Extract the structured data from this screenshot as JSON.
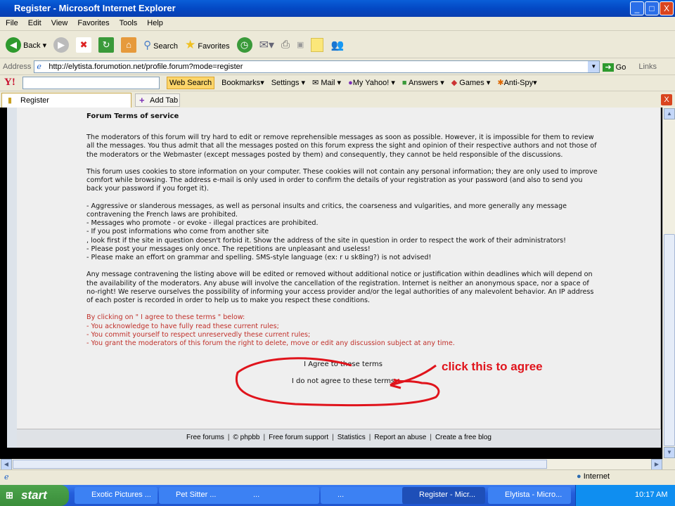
{
  "window": {
    "title": "Register - Microsoft Internet Explorer",
    "minimize": "_",
    "maximize": "□",
    "close": "X"
  },
  "menu": [
    "File",
    "Edit",
    "View",
    "Favorites",
    "Tools",
    "Help"
  ],
  "toolbar": {
    "back": "Back",
    "search": "Search",
    "favorites": "Favorites"
  },
  "address": {
    "label": "Address",
    "url": "http://elytista.forumotion.net/profile.forum?mode=register",
    "go": "Go",
    "links": "Links"
  },
  "yahoo": {
    "logo": "Y!",
    "search_value": "",
    "web_search": "Web Search",
    "bookmarks": "Bookmarks",
    "settings": "Settings",
    "mail": "Mail",
    "my_yahoo": "My Yahoo!",
    "answers": "Answers",
    "games": "Games",
    "anti_spy": "Anti-Spy"
  },
  "tabs": {
    "active": "Register",
    "add": "Add Tab"
  },
  "page": {
    "heading": "Forum Terms of service",
    "paragraphs": [
      "The moderators of this forum will try hard to edit or remove reprehensible messages as soon as possible. However, it is impossible for them to review all the messages. You thus admit that all the messages posted on this forum express the sight and opinion of their respective authors and not those of the moderators or the Webmaster (except messages posted by them) and consequently, they cannot be held responsible of the discussions.",
      "This forum uses cookies to store information on your computer. These cookies will not contain any personal information; they are only used to improve comfort while browsing. The address e-mail is only used in order to confirm the details of your registration as your password (and also to send you back your password if you forget it)."
    ],
    "rules": [
      "- Aggressive or slanderous messages, as well as personal insults and critics, the coarseness and vulgarities, and more generally any message contravening the French laws are prohibited.",
      "- Messages who promote - or evoke - illegal practices are prohibited.",
      "- If you post informations who come from another site",
      ", look first if the site in question doesn't forbid it. Show the address of the site in question in order to respect the work of their administrators!",
      "- Please post your messages only once. The repetitions are unpleasant and useless!",
      "- Please make an effort on grammar and spelling. SMS-style language (ex: r u sk8ing?) is not advised!"
    ],
    "closing": "Any message contravening the listing above will be edited or removed without additional notice or justification within deadlines which will depend on the availability of the moderators. Any abuse will involve the cancellation of the registration. Internet is neither an anonymous space, nor a space of no-right! We reserve ourselves the possibility of informing your access provider and/or the legal authorities of any malevolent behavior. An IP address of each poster is recorded in order to help us to make you respect these conditions.",
    "agreement": [
      "By clicking on \" I agree to these terms \" below:",
      "- You acknowledge to have fully read these current rules;",
      "- You commit yourself to respect unreservedly these current rules;",
      "- You grant the moderators of this forum the right to delete, move or edit any discussion subject at any time."
    ],
    "agree_link": "I Agree to these terms",
    "disagree_link": "I do not agree to these terms",
    "annotation": "click this to agree"
  },
  "footer": [
    "Free forums",
    "© phpbb",
    "Free forum support",
    "Statistics",
    "Report an abuse",
    "Create a free blog"
  ],
  "status": {
    "zone": "Internet"
  },
  "taskbar": {
    "start": "start",
    "items": [
      "Exotic Pictures ...",
      "Pet Sitter ...",
      "...",
      "...",
      "Register - Micr...",
      "Elytista - Micro..."
    ],
    "clock": "10:17 AM"
  },
  "colors": {
    "red_text": "#c0302a",
    "annotation": "#e0141c",
    "titlebar": "#0348c4"
  }
}
